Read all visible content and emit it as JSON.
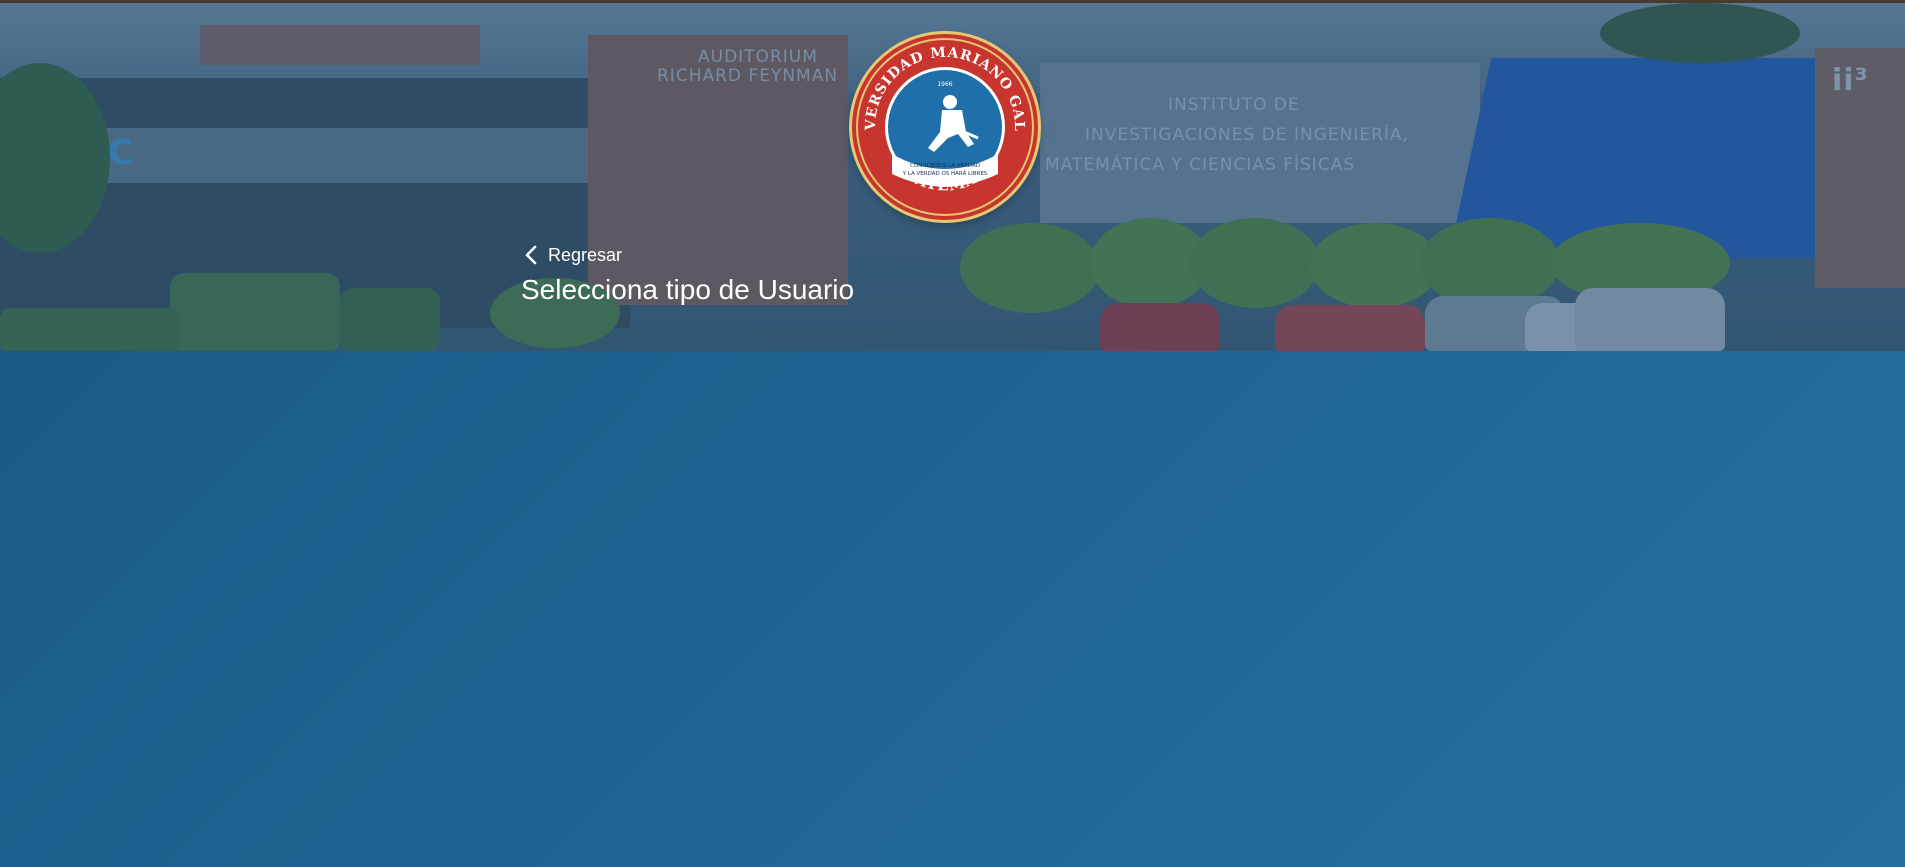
{
  "hero": {
    "background": "campus-building-photo",
    "facade_texts": [
      "AUDITORIUM",
      "RICHARD FEYNMAN",
      "INSTITUTO DE",
      "INVESTIGACIONES DE INGENIERÍA,",
      "MATEMÁTICA Y CIENCIAS FÍSICAS",
      "ITC",
      "ii³"
    ]
  },
  "logo": {
    "top_text": "UNIVERSIDAD MARIANO GALVEZ",
    "bottom_text": "GUATEMALA",
    "year": "1966",
    "motto_line1": "CONOCERÉIS LA VERDAD",
    "motto_line2": "Y LA VERDAD OS HARÁ LIBRES"
  },
  "nav": {
    "back_label": "Regresar",
    "back_icon": "chevron-left-icon"
  },
  "page": {
    "title": "Selecciona tipo de Usuario"
  },
  "colors": {
    "panel": "#1f6695",
    "overlay": "#14467a",
    "seal_red": "#c7352e",
    "seal_blue": "#1f6fab",
    "text": "#ffffff"
  }
}
